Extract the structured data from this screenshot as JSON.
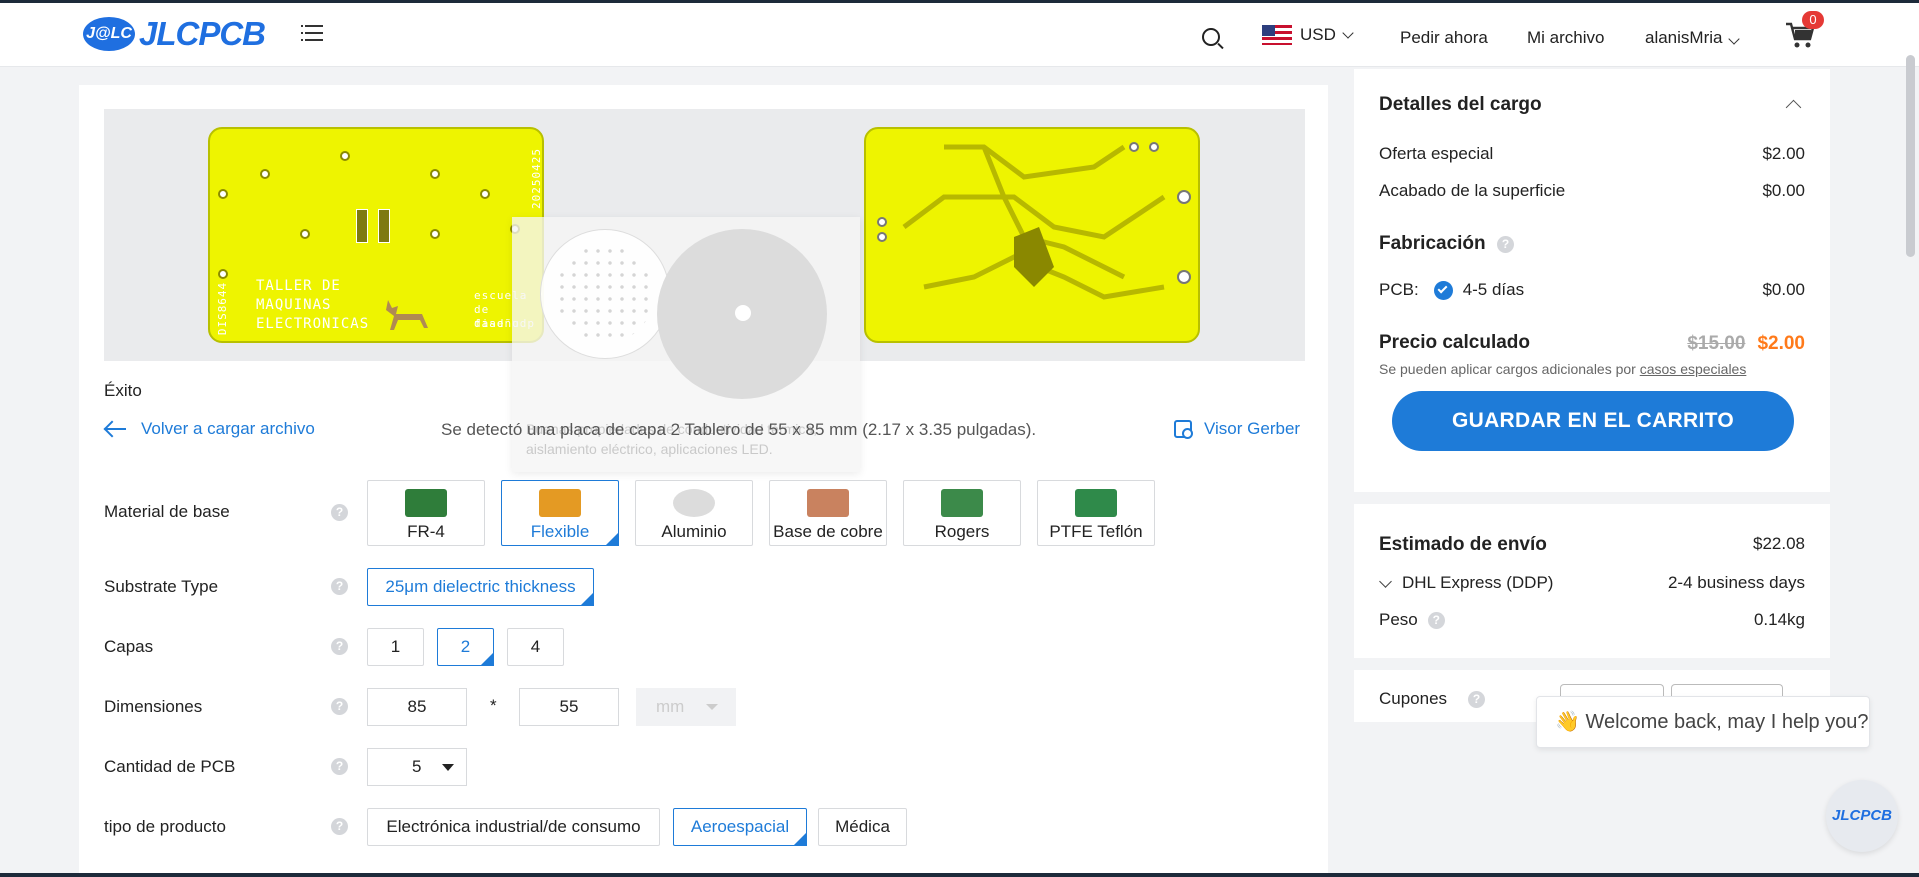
{
  "header": {
    "logo_badge": "J@LC",
    "logo_text": "JLCPCB",
    "currency": "USD",
    "nav_order": "Pedir ahora",
    "nav_files": "Mi archivo",
    "user": "alanisMria",
    "cart_count": "0"
  },
  "preview": {
    "pcb_text_1": "TALLER DE",
    "pcb_text_2": "MAQUINAS",
    "pcb_text_3": "ELECTRONICAS",
    "pcb_text_school_1": "escuela",
    "pcb_text_school_2": "de diseño",
    "pcb_text_school_3": "faad udp",
    "pcb_side_code": "DIS8644",
    "pcb_date_code": "20250425",
    "tooltip_text": "Buenas propiedades de conductividad térmica, aislamiento eléctrico, aplicaciones LED."
  },
  "status": "Éxito",
  "back_link": "Volver a cargar archivo",
  "detected": "Se detectó una placa de capa 2 Tablero de 55 x 85 mm (2.17 x 3.35 pulgadas).",
  "gerber_link": "Visor Gerber",
  "options": {
    "base_material_label": "Material de base",
    "materials": [
      "FR-4",
      "Flexible",
      "Aluminio",
      "Base de cobre",
      "Rogers",
      "PTFE Teflón"
    ],
    "selected_material": "Flexible",
    "substrate_label": "Substrate Type",
    "substrate_value": "25μm dielectric thickness",
    "layers_label": "Capas",
    "layers": [
      "1",
      "2",
      "4"
    ],
    "selected_layers": "2",
    "dimensions_label": "Dimensiones",
    "dim_x": "85",
    "dim_sep": "*",
    "dim_y": "55",
    "dim_unit": "mm",
    "qty_label": "Cantidad de PCB",
    "qty_value": "5",
    "product_label": "tipo de producto",
    "product_types": [
      "Electrónica industrial/de consumo",
      "Aeroespacial",
      "Médica"
    ],
    "selected_product": "Aeroespacial"
  },
  "charges": {
    "title": "Detalles del cargo",
    "special_offer_label": "Oferta especial",
    "special_offer_value": "$2.00",
    "finish_label": "Acabado de la superficie",
    "finish_value": "$0.00",
    "fab_title": "Fabricación",
    "pcb_label": "PCB:",
    "pcb_days": "4-5 días",
    "pcb_value": "$0.00",
    "calc_label": "Precio calculado",
    "old_price": "$15.00",
    "new_price": "$2.00",
    "note_prefix": "Se pueden aplicar cargos adicionales por",
    "note_link": "casos especiales",
    "save_button": "GUARDAR EN EL CARRITO"
  },
  "shipping": {
    "title": "Estimado de envío",
    "total": "$22.08",
    "method": "DHL Express (DDP)",
    "days": "2-4 business days",
    "weight_label": "Peso",
    "weight_value": "0.14kg"
  },
  "coupons": {
    "label": "Cupones"
  },
  "chat": {
    "greeting": "👋 Welcome back, may I help you?",
    "button": "JLCPCB"
  },
  "colors": {
    "accent": "#1e7bd8",
    "price_orange": "#ff7a1a",
    "pcb_yellow": "#eef400"
  }
}
